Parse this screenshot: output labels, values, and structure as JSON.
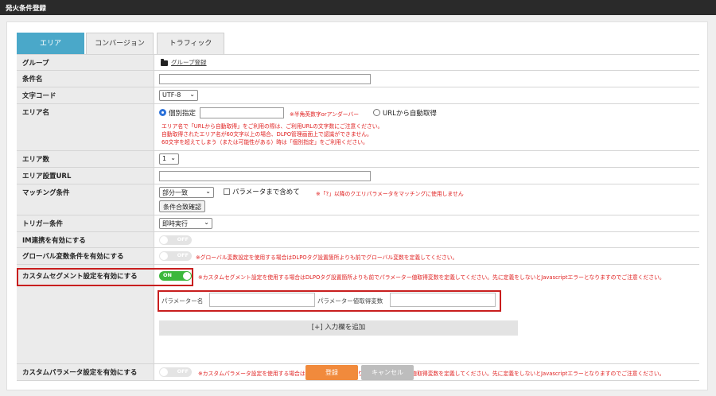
{
  "window": {
    "title": "発火条件登録"
  },
  "tabs": [
    {
      "label": "エリア",
      "active": true
    },
    {
      "label": "コンバージョン",
      "active": false
    },
    {
      "label": "トラフィック",
      "active": false
    }
  ],
  "form": {
    "group": {
      "label": "グループ",
      "link": "グループ登録"
    },
    "condition_name": {
      "label": "条件名",
      "value": ""
    },
    "charset": {
      "label": "文字コード",
      "selected": "UTF-8"
    },
    "area_name": {
      "label": "エリア名",
      "option_manual": "個別指定",
      "manual_value": "",
      "manual_note": "※半角英数字orアンダーバー",
      "option_auto": "URLから自動取得",
      "notes": [
        "エリア名で「URLから自動取得」をご利用の際は、ご利用URLの文字数にご注意ください。",
        "自動取得されたエリア名が60文字以上の場合、DLPO管理画面上で認識ができません。",
        "60文字を超えてしまう（または可能性がある）時は「個別指定」をご利用ください。"
      ]
    },
    "area_count": {
      "label": "エリア数",
      "selected": "1"
    },
    "area_url": {
      "label": "エリア設置URL",
      "value": ""
    },
    "matching": {
      "label": "マッチング条件",
      "selected": "部分一致",
      "include_params": "パラメータまで含めて",
      "note": "※「?」以降のクエリパラメータをマッチングに使用しません",
      "check_button": "条件合致確認"
    },
    "trigger": {
      "label": "トリガー条件",
      "selected": "即時実行"
    },
    "im": {
      "label": "IM連携を有効にする",
      "toggle": "OFF"
    },
    "global_var": {
      "label": "グローバル変数条件を有効にする",
      "toggle": "OFF",
      "note": "※グローバル変数設定を使用する場合はDLPOタグ設置箇所よりも前でグローバル変数を定義してください。"
    },
    "custom_segment": {
      "label": "カスタムセグメント設定を有効にする",
      "toggle": "ON",
      "note": "※カスタムセグメント設定を使用する場合はDLPOタグ設置箇所よりも前でパラメーター値取得変数を定義してください。先に定義をしないとJavascriptエラーとなりますのでご注意ください。",
      "param_name_label": "パラメーター名",
      "param_name_value": "",
      "param_var_label": "パラメーター値取得変数",
      "param_var_value": "",
      "add_button": "[+] 入力欄を追加"
    },
    "custom_param": {
      "label": "カスタムパラメータ設定を有効にする",
      "toggle": "OFF",
      "note": "※カスタムパラメータ設定を使用する場合はDLPOタグ設置箇所よりも前でパラメーター値取得変数を定義してください。先に定義をしないとJavascriptエラーとなりますのでご注意ください。"
    }
  },
  "actions": {
    "submit": "登録",
    "cancel": "キャンセル"
  },
  "icons": {
    "folder": "folder-icon",
    "chevron": "chevron-down-icon"
  },
  "colors": {
    "tab_active": "#4aa8c9",
    "note_red": "#e02020",
    "toggle_on": "#3cb83c",
    "submit": "#f18a3c",
    "highlight": "#c81e1e"
  }
}
